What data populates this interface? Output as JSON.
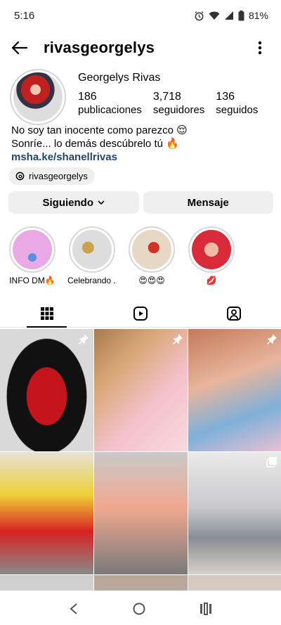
{
  "status_bar": {
    "time": "5:16",
    "battery": "81%"
  },
  "header": {
    "username": "rivasgeorgelys"
  },
  "profile": {
    "name": "Georgelys Rivas",
    "stats": [
      {
        "value": "186",
        "label": "publicaciones"
      },
      {
        "value": "3,718",
        "label": "seguidores"
      },
      {
        "value": "136",
        "label": "seguidos"
      }
    ],
    "bio_line1": "No soy tan inocente como parezco 😌",
    "bio_line2": "Sonríe... lo demás descúbrelo tú 🔥",
    "link": "msha.ke/shanellrivas",
    "threads_handle": "rivasgeorgelys"
  },
  "actions": {
    "following": "Siguiendo",
    "message": "Mensaje"
  },
  "highlights": [
    {
      "label": "INFO DM🔥"
    },
    {
      "label": "Celebrando ..."
    },
    {
      "label": "😍😍😍"
    },
    {
      "label": "💋"
    }
  ],
  "tabs": [
    "grid-icon",
    "reels-icon",
    "tagged-icon"
  ]
}
